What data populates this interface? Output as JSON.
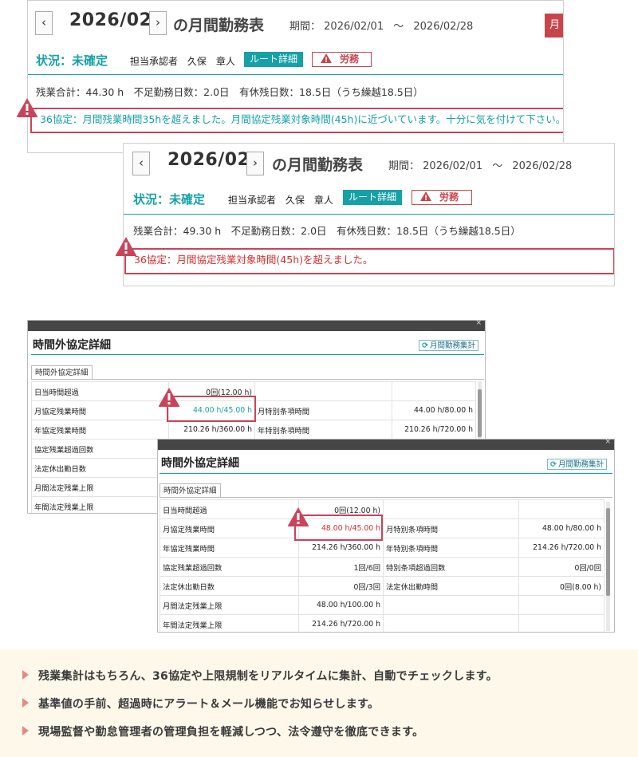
{
  "panel1": {
    "year": "2026/02",
    "title_suffix": "の月間勤務表",
    "period_label": "期間：",
    "period_start": "2026/02/01",
    "period_sep": "〜",
    "period_end": "2026/02/28",
    "right_tab": "月",
    "status": "状況：未確定",
    "approver_label": "担当承認者",
    "approver_name": "久保　章人",
    "route_button": "ルート詳細",
    "labor_button": "労務",
    "summary": "残業合計：44.30 h　不足勤務日数：2.0日　有休残日数：18.5日（うち繰越18.5日）",
    "alert": "36協定：月間残業時間35hを超えました。月間協定残業対象時間(45h)に近づいています。十分に気を付けて下さい。",
    "alert_color": "#16a0a8"
  },
  "panel2": {
    "year": "2026/02",
    "title_suffix": "の月間勤務表",
    "period_label": "期間：",
    "period_start": "2026/02/01",
    "period_sep": "〜",
    "period_end": "2026/02/28",
    "status": "状況：未確定",
    "approver_label": "担当承認者",
    "approver_name": "久保　章人",
    "route_button": "ルート詳細",
    "labor_button": "労務",
    "summary": "残業合計：49.30 h　不足勤務日数：2.0日　有休残日数：18.5日（うち繰越18.5日）",
    "alert": "36協定：月間協定残業対象時間(45h)を超えました。",
    "alert_color": "#d32f2f"
  },
  "detail1": {
    "title": "時間外協定詳細",
    "summary_button": "月間勤務集計",
    "tab": "時間外協定詳細",
    "rows": [
      [
        "日当時間超過",
        "0回(12.00 h)",
        "",
        ""
      ],
      [
        "月協定残業時間",
        "44.00 h/45.00 h",
        "月特別条項時間",
        "44.00 h/80.00 h"
      ],
      [
        "年協定残業時間",
        "210.26 h/360.00 h",
        "年特別条項時間",
        "210.26 h/720.00 h"
      ],
      [
        "協定残業超過回数",
        "",
        "",
        ""
      ],
      [
        "法定休出勤日数",
        "",
        "",
        ""
      ],
      [
        "月間法定残業上限",
        "",
        "",
        ""
      ],
      [
        "年間法定残業上限",
        "",
        "",
        ""
      ]
    ]
  },
  "detail2": {
    "title": "時間外協定詳細",
    "summary_button": "月間勤務集計",
    "tab": "時間外協定詳細",
    "rows": [
      [
        "日当時間超過",
        "0回(12.00 h)",
        "",
        ""
      ],
      [
        "月協定残業時間",
        "48.00 h/45.00 h",
        "月特別条項時間",
        "48.00 h/80.00 h"
      ],
      [
        "年協定残業時間",
        "214.26 h/360.00 h",
        "年特別条項時間",
        "214.26 h/720.00 h"
      ],
      [
        "協定残業超過回数",
        "1回/6回",
        "特別条項超過回数",
        "0回/0回"
      ],
      [
        "法定休出勤日数",
        "0回/3回",
        "法定休出勤時間",
        "0回(8.00 h)"
      ],
      [
        "月間法定残業上限",
        "48.00 h/100.00 h",
        "",
        ""
      ],
      [
        "年間法定残業上限",
        "214.26 h/720.00 h",
        "",
        ""
      ]
    ]
  },
  "features": [
    "残業集計はもちろん、36協定や上限規制をリアルタイムに集計、自動でチェックします。",
    "基準値の手前、超過時にアラート＆メール機能でお知らせします。",
    "現場監督や勤怠管理者の管理負担を軽減しつつ、法令遵守を徹底できます。"
  ],
  "colors": {
    "teal": "#16a0a8",
    "alert_red": "#c9445a",
    "band": "#fdf8ea"
  }
}
